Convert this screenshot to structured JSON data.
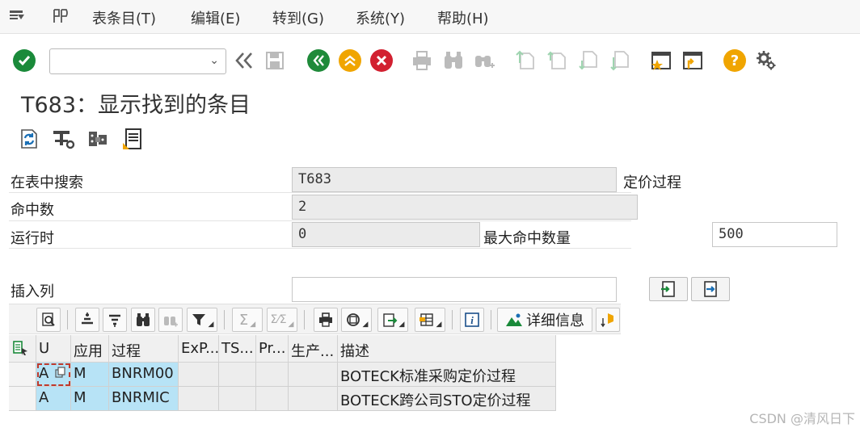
{
  "menu": {
    "items": [
      "表条目(T)",
      "编辑(E)",
      "转到(G)",
      "系统(Y)",
      "帮助(H)"
    ]
  },
  "toolbar": {
    "command_value": "",
    "icons": [
      "enter-check-icon",
      "back-double-arrow-icon",
      "save-icon",
      "back-icon",
      "exit-icon",
      "cancel-icon",
      "print-icon",
      "find-icon",
      "find-next-icon",
      "first-page-icon",
      "previous-page-icon",
      "next-page-icon",
      "last-page-icon",
      "create-shortcut-icon",
      "create-session-icon",
      "help-icon",
      "customize-layout-icon"
    ]
  },
  "title": "T683：显示找到的条目",
  "form": {
    "search_table_label": "在表中搜索",
    "search_table_value": "T683",
    "search_table_desc": "定价过程",
    "hits_label": "命中数",
    "hits_value": "2",
    "runtime_label": "运行时",
    "runtime_value": "0",
    "max_hits_label": "最大命中数量",
    "max_hits_value": "500",
    "insert_col_label": "插入列",
    "insert_col_value": ""
  },
  "alv": {
    "details_label": "详细信息"
  },
  "grid": {
    "columns": [
      "U",
      "应用",
      "过程",
      "ExP...",
      "TS...",
      "Pr...",
      "生产...",
      "描述"
    ],
    "rows": [
      [
        "A",
        "M",
        "BNRM00",
        "",
        "",
        "",
        "",
        "BOTECK标准采购定价过程"
      ],
      [
        "A",
        "M",
        "BNRMIC",
        "",
        "",
        "",
        "",
        "BOTECK跨公司STO定价过程"
      ]
    ]
  },
  "watermark": "CSDN @清风日下",
  "colors": {
    "key_cell": "#b7e3f6",
    "ok_green": "#1a8a3a",
    "back_green": "#1f8a3a",
    "exit_orange": "#f0a500",
    "cancel_red": "#d22030",
    "help_orange": "#f0a500"
  }
}
